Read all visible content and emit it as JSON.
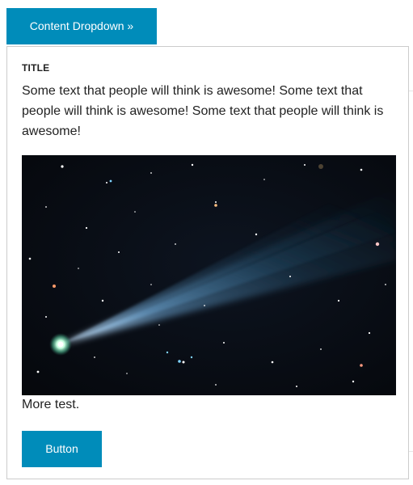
{
  "trigger": {
    "label": "Content Dropdown »"
  },
  "dropdown": {
    "title": "TITLE",
    "body_text": "Some text that people will think is awesome! Some text that people will think is awesome! Some text that people will think is awesome!",
    "image_alt": "comet",
    "more_text": "More test.",
    "button_label": "Button"
  },
  "colors": {
    "accent": "#008cba",
    "border": "#cccccc",
    "text": "#222222"
  }
}
